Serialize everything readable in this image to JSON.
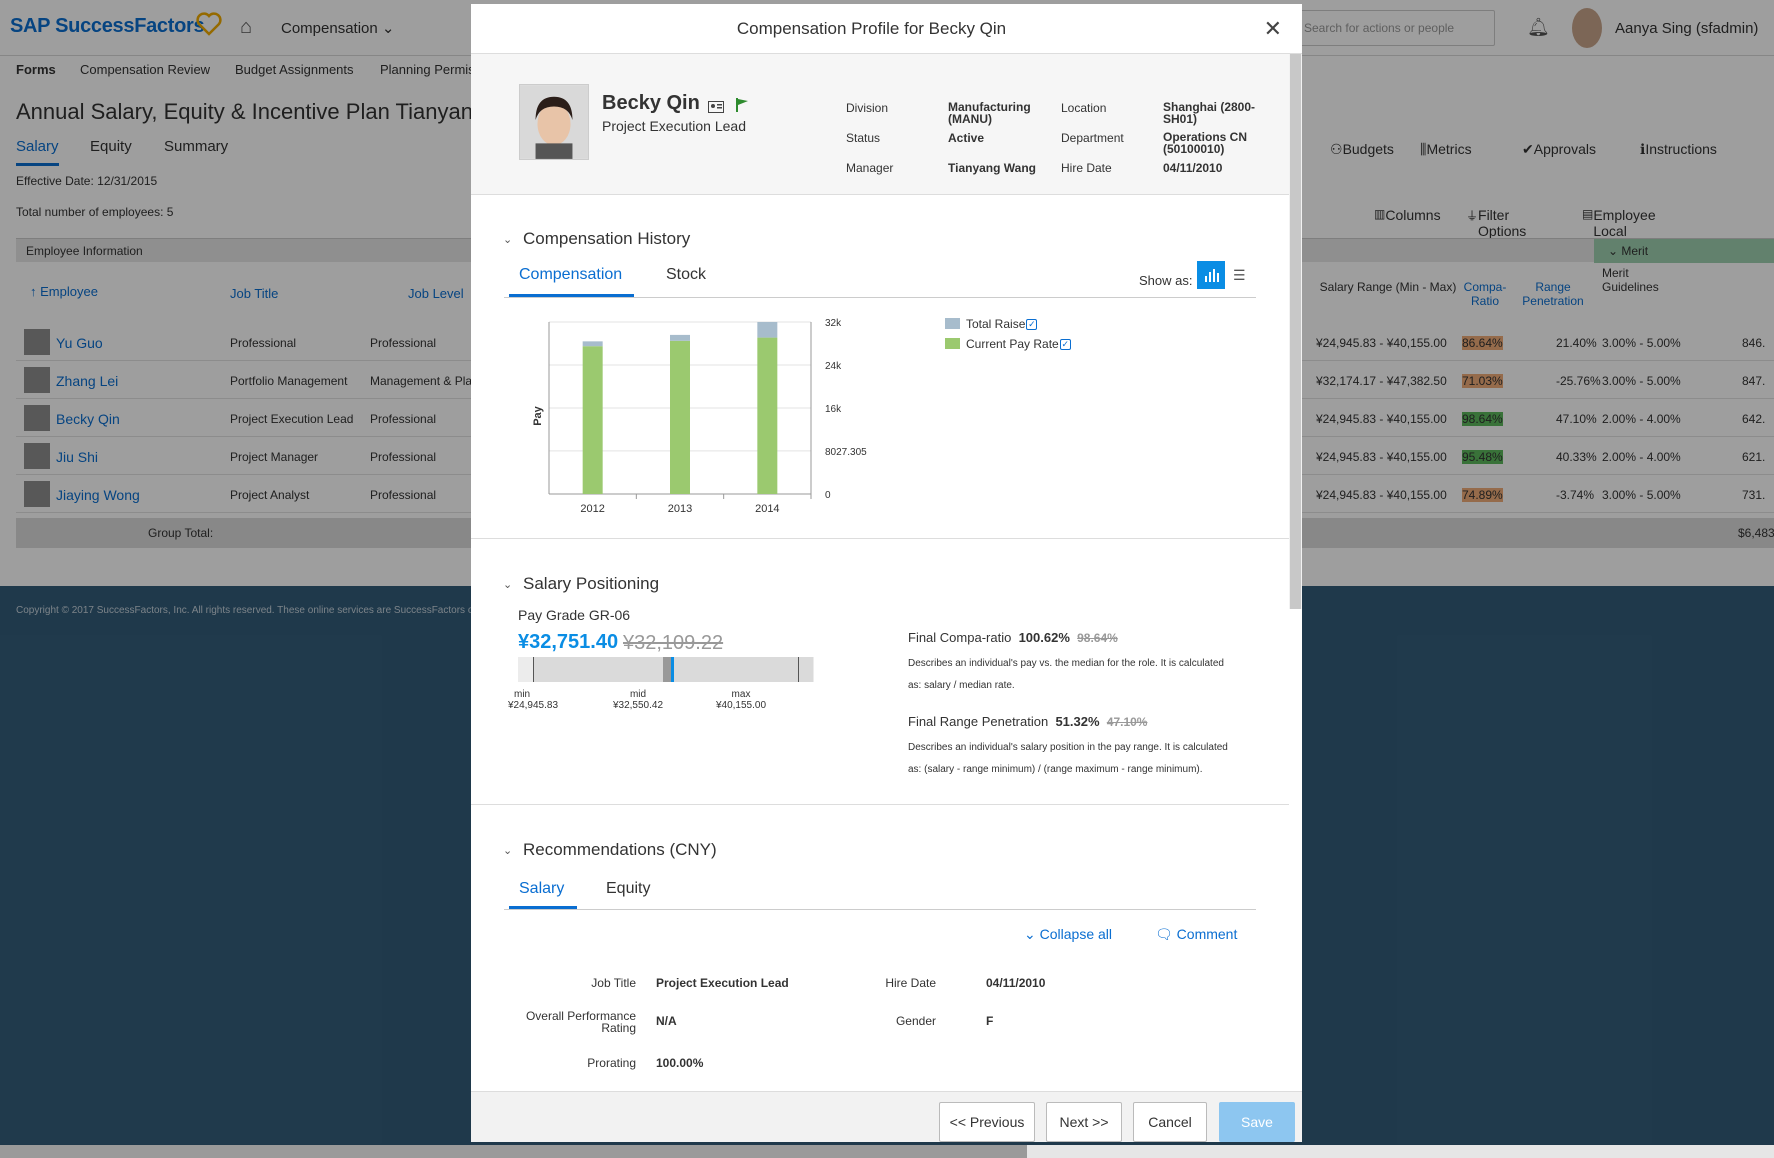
{
  "app": {
    "brand": "SAP SuccessFactors",
    "module": "Compensation",
    "search_placeholder": "Search for actions or people",
    "user": "Aanya Sing (sfadmin)"
  },
  "subnav": [
    "Forms",
    "Compensation Review",
    "Budget Assignments",
    "Planning Permis"
  ],
  "page": {
    "title": "Annual Salary, Equity & Incentive Plan Tianyang",
    "tabs": [
      "Salary",
      "Equity",
      "Summary"
    ],
    "effective_date": "Effective Date: 12/31/2015",
    "total_employees": "Total number of employees: 5",
    "toolbar": [
      "Budgets",
      "Metrics",
      "Approvals",
      "Instructions"
    ],
    "tools": [
      "Columns",
      "Filter Options",
      "Employee Local Currency"
    ],
    "employee_info": "Employee Information",
    "merit": "Merit",
    "columns": {
      "employee": "Employee",
      "job_title": "Job Title",
      "job_level": "Job Level",
      "salary_range": "Salary Range (Min - Max)",
      "compa_ratio": "Compa-Ratio",
      "range_penetration": "Range Penetration",
      "merit_guidelines": "Merit Guidelines"
    },
    "rows": [
      {
        "name": "Yu Guo",
        "title": "Professional",
        "level": "Professional",
        "range": "¥24,945.83 - ¥40,155.00",
        "compa": "86.64%",
        "pen": "21.40%",
        "guide": "3.00% - 5.00%",
        "val": "846."
      },
      {
        "name": "Zhang Lei",
        "title": "Portfolio Management",
        "level": "Management & Pla",
        "range": "¥32,174.17 - ¥47,382.50",
        "compa": "71.03%",
        "pen": "-25.76%",
        "guide": "3.00% - 5.00%",
        "val": "847."
      },
      {
        "name": "Becky Qin",
        "title": "Project Execution Lead",
        "level": "Professional",
        "range": "¥24,945.83 - ¥40,155.00",
        "compa": "98.64%",
        "pen": "47.10%",
        "guide": "2.00% - 4.00%",
        "val": "642."
      },
      {
        "name": "Jiu Shi",
        "title": "Project Manager",
        "level": "Professional",
        "range": "¥24,945.83 - ¥40,155.00",
        "compa": "95.48%",
        "pen": "40.33%",
        "guide": "2.00% - 4.00%",
        "val": "621."
      },
      {
        "name": "Jiaying Wong",
        "title": "Project Analyst",
        "level": "Professional",
        "range": "¥24,945.83 - ¥40,155.00",
        "compa": "74.89%",
        "pen": "-3.74%",
        "guide": "3.00% - 5.00%",
        "val": "731."
      }
    ],
    "group_total": "Group Total:",
    "group_total_value": "$6,483",
    "copyright": "Copyright © 2017 SuccessFactors, Inc. All rights reserved. These online services are SuccessFactors o"
  },
  "modal": {
    "title": "Compensation Profile for Becky Qin",
    "person": {
      "name": "Becky Qin",
      "title": "Project Execution Lead"
    },
    "fields": {
      "division_label": "Division",
      "division": "Manufacturing (MANU)",
      "status_label": "Status",
      "status": "Active",
      "manager_label": "Manager",
      "manager": "Tianyang Wang",
      "location_label": "Location",
      "location": "Shanghai (2800-SH01)",
      "department_label": "Department",
      "department": "Operations CN (50100010)",
      "hire_label": "Hire Date",
      "hire": "04/11/2010"
    },
    "comp_history": {
      "heading": "Compensation History",
      "tabs": [
        "Compensation",
        "Stock"
      ],
      "show_as": "Show as:"
    },
    "positioning": {
      "heading": "Salary Positioning",
      "pay_grade": "Pay Grade GR-06",
      "current": "¥32,751.40",
      "previous": "¥32,109.22",
      "min_label": "min",
      "min": "¥24,945.83",
      "mid_label": "mid",
      "mid": "¥32,550.42",
      "max_label": "max",
      "max": "¥40,155.00",
      "compa_label": "Final Compa-ratio",
      "compa": "100.62%",
      "compa_old": "98.64%",
      "compa_desc": "Describes an individual's pay vs. the median for the role. It is calculated as: salary / median rate.",
      "pen_label": "Final Range Penetration",
      "pen": "51.32%",
      "pen_old": "47.10%",
      "pen_desc": "Describes an individual's salary position in the pay range. It is calculated as: (salary - range minimum) / (range maximum - range minimum)."
    },
    "recs": {
      "heading": "Recommendations (CNY)",
      "tabs": [
        "Salary",
        "Equity"
      ],
      "collapse": "Collapse all",
      "comment": "Comment",
      "job_title_label": "Job Title",
      "job_title": "Project Execution Lead",
      "hire_label": "Hire Date",
      "hire": "04/11/2010",
      "perf_label": "Overall Performance Rating",
      "perf": "N/A",
      "gender_label": "Gender",
      "gender": "F",
      "prorating_label": "Prorating",
      "prorating": "100.00%"
    },
    "buttons": {
      "prev": "<< Previous",
      "next": "Next >>",
      "cancel": "Cancel",
      "save": "Save"
    }
  },
  "colors": {
    "accent": "#0a6ed1",
    "raise": "#a7bccc",
    "pay": "#9bc96f",
    "compa_orange": "#f0ad7a",
    "compa_green": "#5cb85c"
  },
  "chart_data": {
    "type": "bar",
    "stacked": true,
    "categories": [
      "2012",
      "2013",
      "2014"
    ],
    "series": [
      {
        "name": "Current Pay Rate",
        "values": [
          27500,
          28500,
          29100
        ]
      },
      {
        "name": "Total Raise",
        "values": [
          900,
          1100,
          2900
        ]
      }
    ],
    "ylabel": "Pay",
    "ylim": [
      0,
      32000
    ],
    "yticks": [
      "0",
      "8027.305",
      "16k",
      "24k",
      "32k"
    ],
    "legend": [
      "Total Raise",
      "Current Pay Rate"
    ],
    "legend_position": "right",
    "y_axis_side": "right"
  }
}
